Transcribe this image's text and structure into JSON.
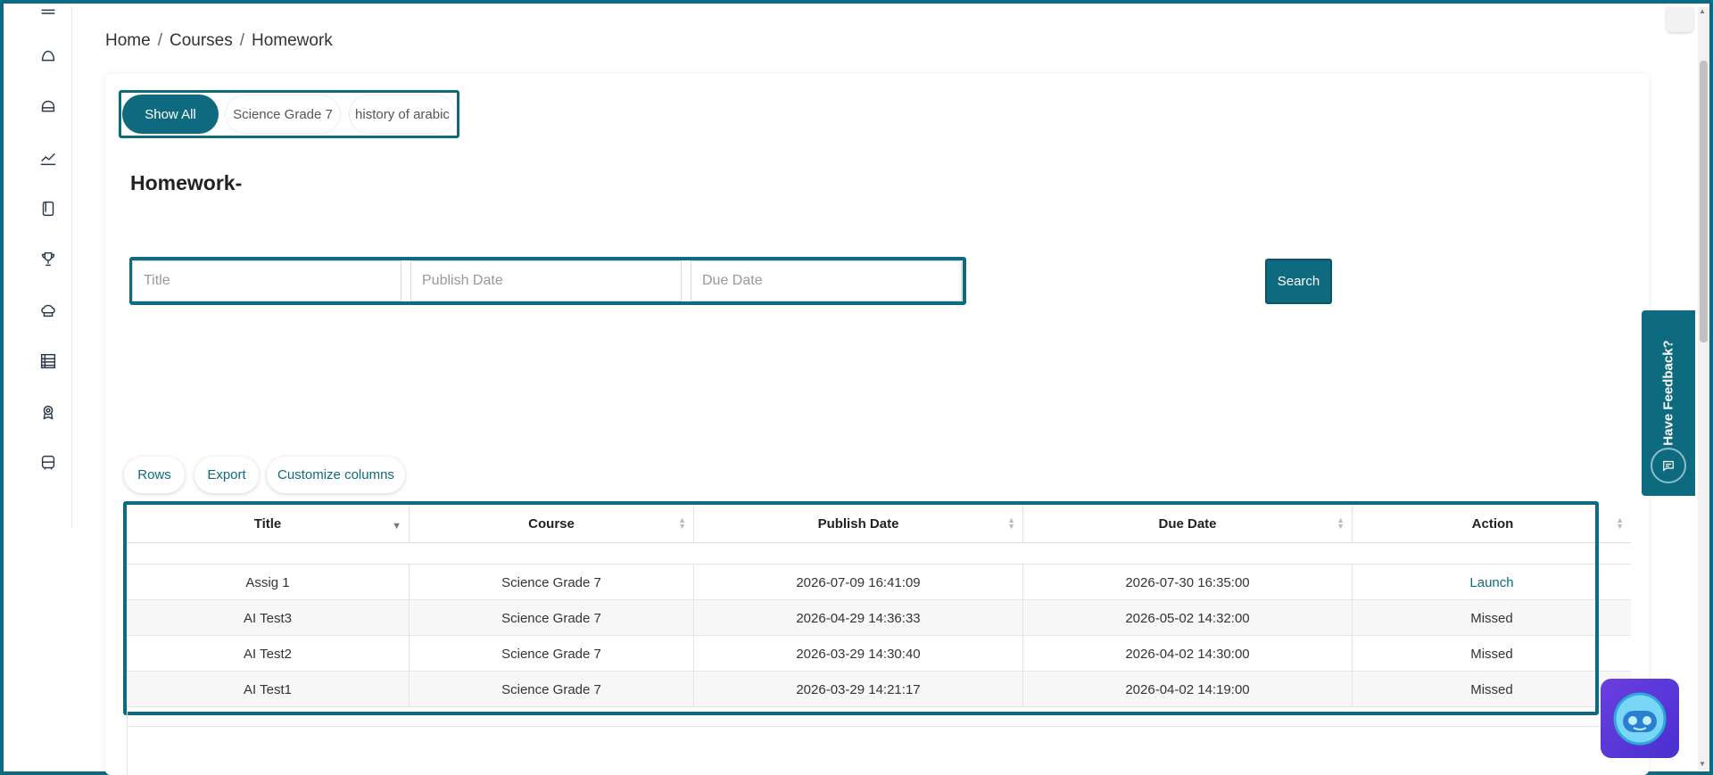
{
  "breadcrumb": {
    "home": "Home",
    "sep1": "/",
    "courses": "Courses",
    "sep2": "/",
    "current": "Homework"
  },
  "tabs": [
    {
      "label": "Show All",
      "active": true
    },
    {
      "label": "Science Grade 7",
      "active": false
    },
    {
      "label": "history of arabic",
      "active": false
    }
  ],
  "page_title": "Homework-",
  "filters": {
    "title_placeholder": "Title",
    "publish_placeholder": "Publish Date",
    "due_placeholder": "Due Date",
    "search_label": "Search"
  },
  "table_controls": {
    "rows": "Rows",
    "export": "Export",
    "customize": "Customize columns"
  },
  "table": {
    "headers": [
      "Title",
      "Course",
      "Publish Date",
      "Due Date",
      "Action"
    ],
    "rows": [
      [
        "Assig 1",
        "Science Grade 7",
        "2026-07-09 16:41:09",
        "2026-07-30 16:35:00",
        "Launch"
      ],
      [
        "AI Test3",
        "Science Grade 7",
        "2026-04-29 14:36:33",
        "2026-05-02 14:32:00",
        "Missed"
      ],
      [
        "AI Test2",
        "Science Grade 7",
        "2026-03-29 14:30:40",
        "2026-04-02 14:30:00",
        "Missed"
      ],
      [
        "AI Test1",
        "Science Grade 7",
        "2026-03-29 14:21:17",
        "2026-04-02 14:19:00",
        "Missed"
      ]
    ]
  },
  "feedback": {
    "label": "Have Feedback?"
  },
  "sidebar_icons": [
    "home-icon",
    "courses-icon",
    "analytics-icon",
    "book-icon",
    "trophy-icon",
    "chef-hat-icon",
    "list-icon",
    "award-icon",
    "bus-icon"
  ],
  "colors": {
    "accent": "#0e6b7f",
    "bot": "#5a34d8"
  }
}
